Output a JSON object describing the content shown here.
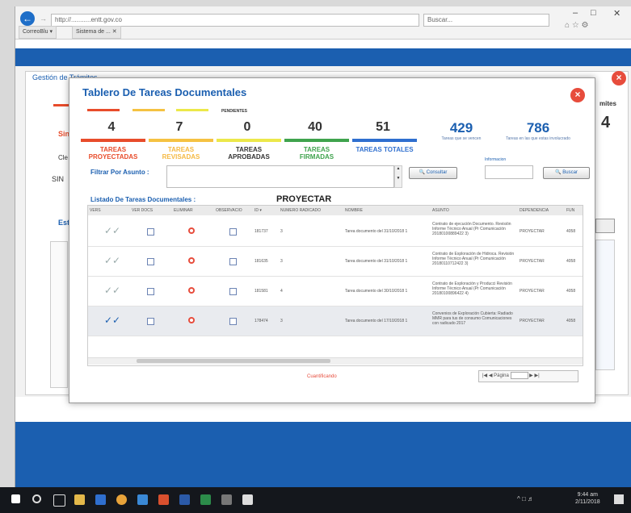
{
  "browser": {
    "address": "http://...........entt.gov.co",
    "search_placeholder": "Buscar...",
    "tabs": [
      "CorreoBlu ▾",
      "Sistema de ... ✕"
    ]
  },
  "background": {
    "title": "Gestión de Trámites",
    "left_labels": [
      "Sin",
      "Cle",
      "SIN",
      "Esta"
    ],
    "right_number": "4",
    "right_label": "mites"
  },
  "modal": {
    "title": "Tablero De Tareas Documentales",
    "pendientes_label": "PENDIENTES",
    "stats": [
      {
        "value": "4",
        "label": "TAREAS PROYECTADAS",
        "color": "#e84c2b"
      },
      {
        "value": "7",
        "label": "TAREAS REVISADAS",
        "color": "#f5c242"
      },
      {
        "value": "0",
        "label": "TAREAS APROBADAS",
        "color": "#ece84a"
      },
      {
        "value": "40",
        "label": "TAREAS FIRMADAS",
        "color": "#3fa34d"
      },
      {
        "value": "51",
        "label": "TAREAS TOTALES",
        "color": "#2f6fcf"
      }
    ],
    "blue_stats": [
      {
        "value": "429",
        "caption": "Tareas que se vencen"
      },
      {
        "value": "786",
        "caption": "Tareas en las que estas involucrado"
      }
    ],
    "filter_label": "Filtrar Por Asunto :",
    "consult_button": "Consultar",
    "field_label": "Informacion",
    "search_button": "Buscar",
    "list_title": "Listado De Tareas Documentales :",
    "list_filter": "PROYECTAR",
    "columns": [
      "VERS",
      "VER DOCS",
      "ELIMINAR",
      "OBSERVACIO",
      "ID ▾",
      "NUMERO RADICADO",
      "NOMBRE",
      "ASUNTO",
      "DEPENDENCIA",
      "FUN"
    ],
    "rows": [
      {
        "id": "181737",
        "radicado": "3",
        "nombre": "Tarea documento del 31/10/2018 1",
        "asunto": "Contrato de ejecución Documento. Revisión Informe Técnico Anual (Pr Comunicación 20180100889422 3)",
        "dependencia": "PROYECTAR",
        "fun": "4058",
        "selected": false
      },
      {
        "id": "181635",
        "radicado": "3",
        "nombre": "Tarea documento del 31/10/2018 1",
        "asunto": "Contrato de Exploración de Hidroca. Revisión Informe Técnico Anual (Pr Comunicación 20180110712422 3)",
        "dependencia": "PROYECTAR",
        "fun": "4058",
        "selected": false
      },
      {
        "id": "181581",
        "radicado": "4",
        "nombre": "Tarea documento del 30/10/2018 1",
        "asunto": "Contrato de Exploración y Producci Revisión Informe Técnico Anual (Pr Comunicación 20180100896422 4)",
        "dependencia": "PROYECTAR",
        "fun": "4058",
        "selected": false
      },
      {
        "id": "178474",
        "radicado": "3",
        "nombre": "Tarea documento del 17/10/2018 1",
        "asunto": "Convenios de Exploración Cubierta: Radiado MMR para tus de consumo Comunicaciones con radicado 2017",
        "dependencia": "PROYECTAR",
        "fun": "4058",
        "selected": true
      }
    ],
    "footer_text": "Cuantificando",
    "pagination": "Página"
  },
  "taskbar": {
    "time": "9:44 am",
    "date": "2/11/2018"
  },
  "colors": {
    "brand_blue": "#1b5fb0",
    "close_red": "#e74c3c"
  }
}
